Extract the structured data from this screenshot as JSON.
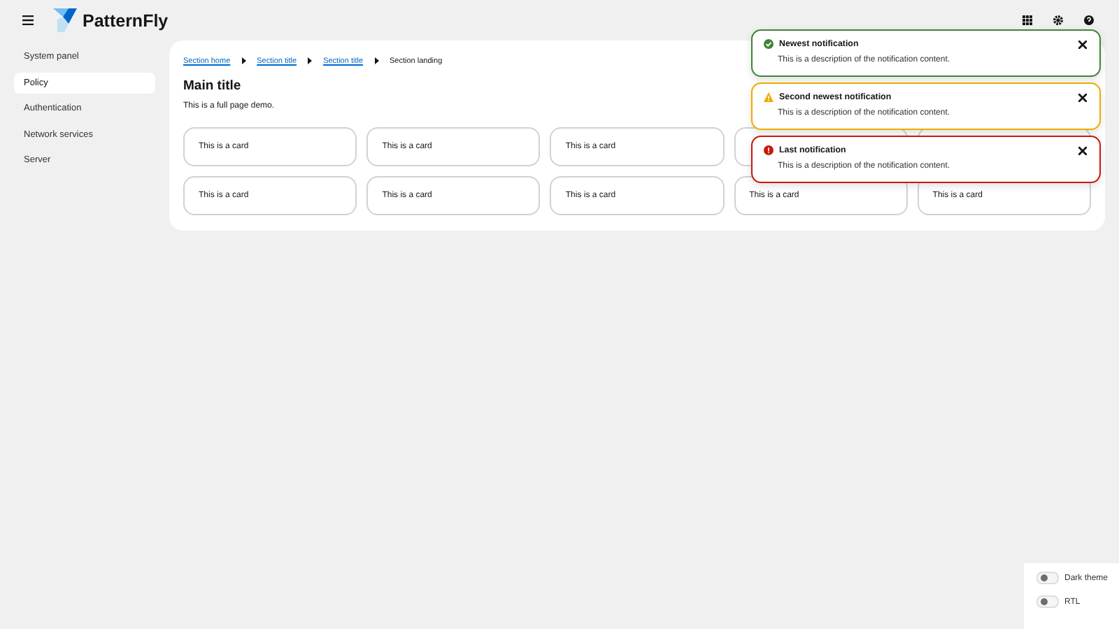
{
  "header": {
    "brand": "PatternFly"
  },
  "sidebar": {
    "items": [
      {
        "label": "System panel",
        "selected": false
      },
      {
        "label": "Policy",
        "selected": true
      },
      {
        "label": "Authentication",
        "selected": false
      },
      {
        "label": "Network services",
        "selected": false
      },
      {
        "label": "Server",
        "selected": false
      }
    ]
  },
  "breadcrumb": [
    {
      "label": "Section home",
      "link": true
    },
    {
      "label": "Section title",
      "link": true
    },
    {
      "label": "Section title",
      "link": true
    },
    {
      "label": "Section landing",
      "link": false
    }
  ],
  "main": {
    "title": "Main title",
    "description": "This is a full page demo."
  },
  "cards": [
    [
      "This is a card",
      "This is a card",
      "This is a card"
    ],
    [
      "This is a card",
      "This is a card",
      "This is a card",
      "This is a card",
      "This is a card"
    ]
  ],
  "notifications": [
    {
      "kind": "success",
      "title": "Newest notification",
      "description": "This is a description of the notification content."
    },
    {
      "kind": "warning",
      "title": "Second newest notification",
      "description": "This is a description of the notification content."
    },
    {
      "kind": "danger",
      "title": "Last notification",
      "description": "This is a description of the notification content."
    }
  ],
  "settings": [
    {
      "label": "Dark theme",
      "on": false
    },
    {
      "label": "RTL",
      "on": false
    }
  ]
}
